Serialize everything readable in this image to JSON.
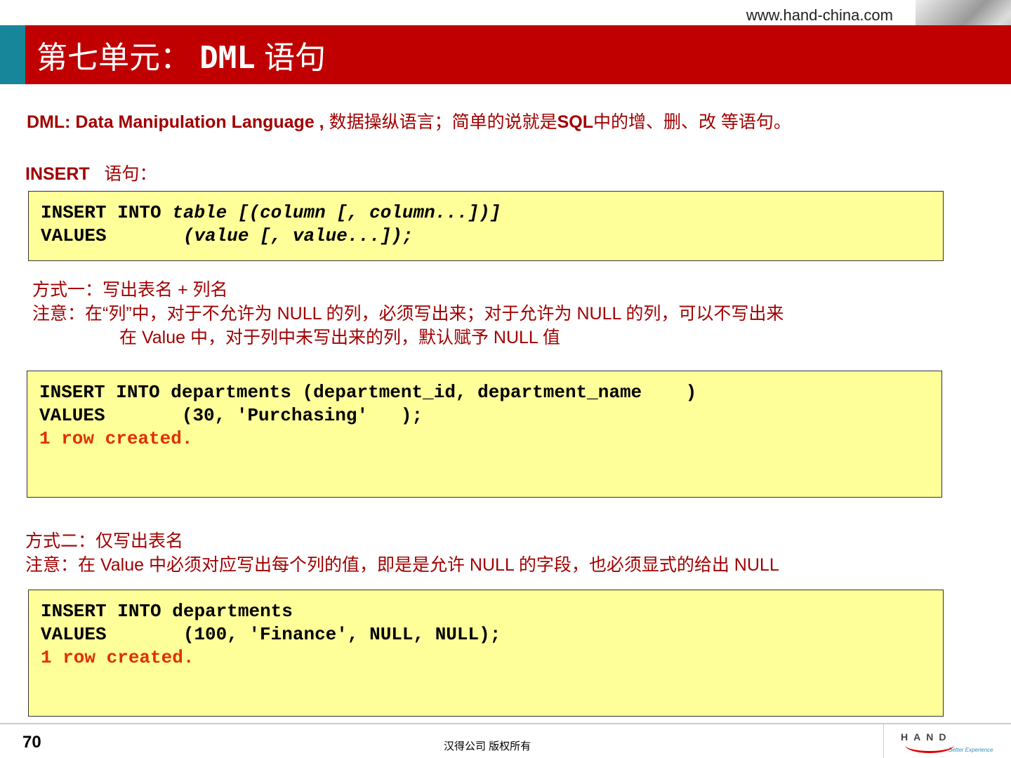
{
  "header": {
    "url": "www.hand-china.com",
    "title_cn": "第七单元：",
    "title_en": "DML",
    "title_cn2": "语句"
  },
  "intro": {
    "en": "DML: Data Manipulation Language ,",
    "cn": "数据操纵语言；简单的说就是",
    "sql": "SQL",
    "cn2": "中的增、删、改 等语句。"
  },
  "insert_heading": {
    "en": "INSERT",
    "cn": "语句："
  },
  "code1": {
    "l1a": "INSERT INTO",
    "l1b": "table [(column [, column...])]",
    "l2a": "VALUES",
    "l2b": "(value [, value...]);"
  },
  "way1": {
    "title": "方式一：写出表名 + 列名",
    "note": "注意：在“列”中，对于不允许为 NULL 的列，必须写出来；对于允许为 NULL 的列，可以不写出来",
    "note2": "在 Value 中，对于列中未写出来的列，默认赋予 NULL 值"
  },
  "code2": {
    "l1a": "INSERT INTO",
    "l1b": "departments (department_id, department_name    )",
    "l2a": "VALUES",
    "l2b": "(30, 'Purchasing'   );",
    "result": "1 row created."
  },
  "way2": {
    "title": "方式二：仅写出表名",
    "note": "注意：在 Value 中必须对应写出每个列的值，即是是允许 NULL 的字段，也必须显式的给出  NULL"
  },
  "code3": {
    "l1a": "INSERT INTO",
    "l1b": "departments",
    "l2a": "VALUES",
    "l2b": "(100, 'Finance', NULL, NULL);",
    "result": "1 row created."
  },
  "footer": {
    "page": "70",
    "copyright": "汉得公司   版权所有",
    "logo": "HAND",
    "tagline": "Better Experience"
  }
}
